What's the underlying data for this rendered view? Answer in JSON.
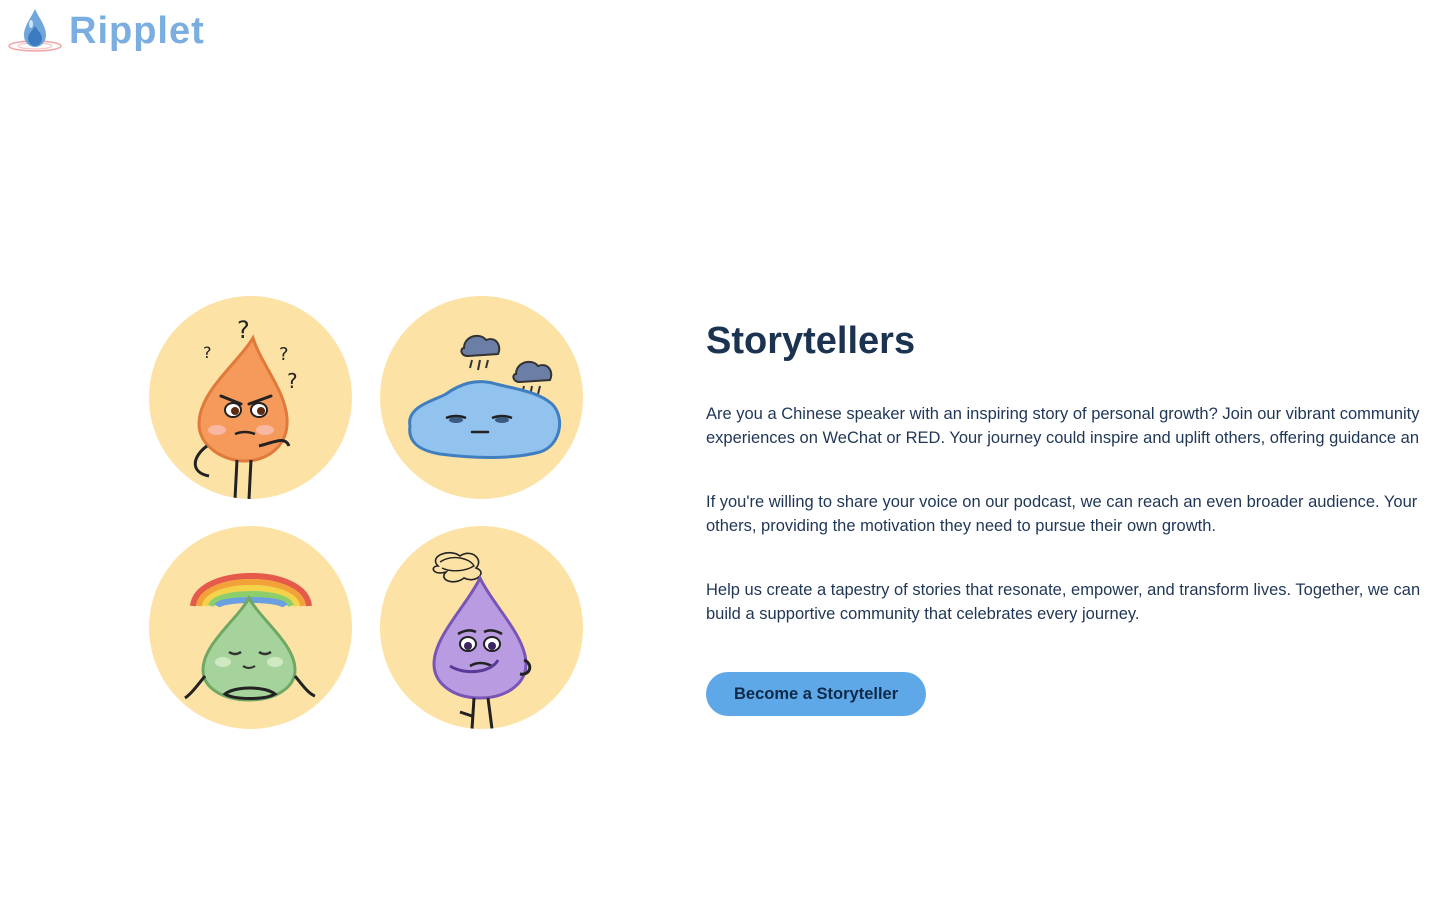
{
  "header": {
    "logo_text": "Ripplet",
    "logo_icon": "water-drop-icon"
  },
  "illustrations": [
    {
      "name": "confused-drop",
      "color": "#f59a5a"
    },
    {
      "name": "sad-puddle",
      "color": "#92c2ee"
    },
    {
      "name": "calm-drop-rainbow",
      "color": "#a6d39c"
    },
    {
      "name": "worried-drop",
      "color": "#b89be0"
    }
  ],
  "section": {
    "title": "Storytellers",
    "paragraphs": [
      {
        "line1": "Are you a Chinese speaker with an inspiring story of personal growth? Join our vibrant community",
        "line2": "experiences on WeChat or RED. Your journey could inspire and uplift others, offering guidance an"
      },
      {
        "line1": "If you're willing to share your voice on our podcast, we can reach an even broader audience. Your",
        "line2": "others, providing the motivation they need to pursue their own growth."
      },
      {
        "line1": "Help us create a tapestry of stories that resonate, empower, and transform lives. Together, we can",
        "line2": "build a supportive community that celebrates every journey."
      }
    ],
    "cta_label": "Become a Storyteller"
  },
  "colors": {
    "accent": "#5fa8e8",
    "heading": "#1b3350",
    "circle_bg": "#fde2a6"
  }
}
